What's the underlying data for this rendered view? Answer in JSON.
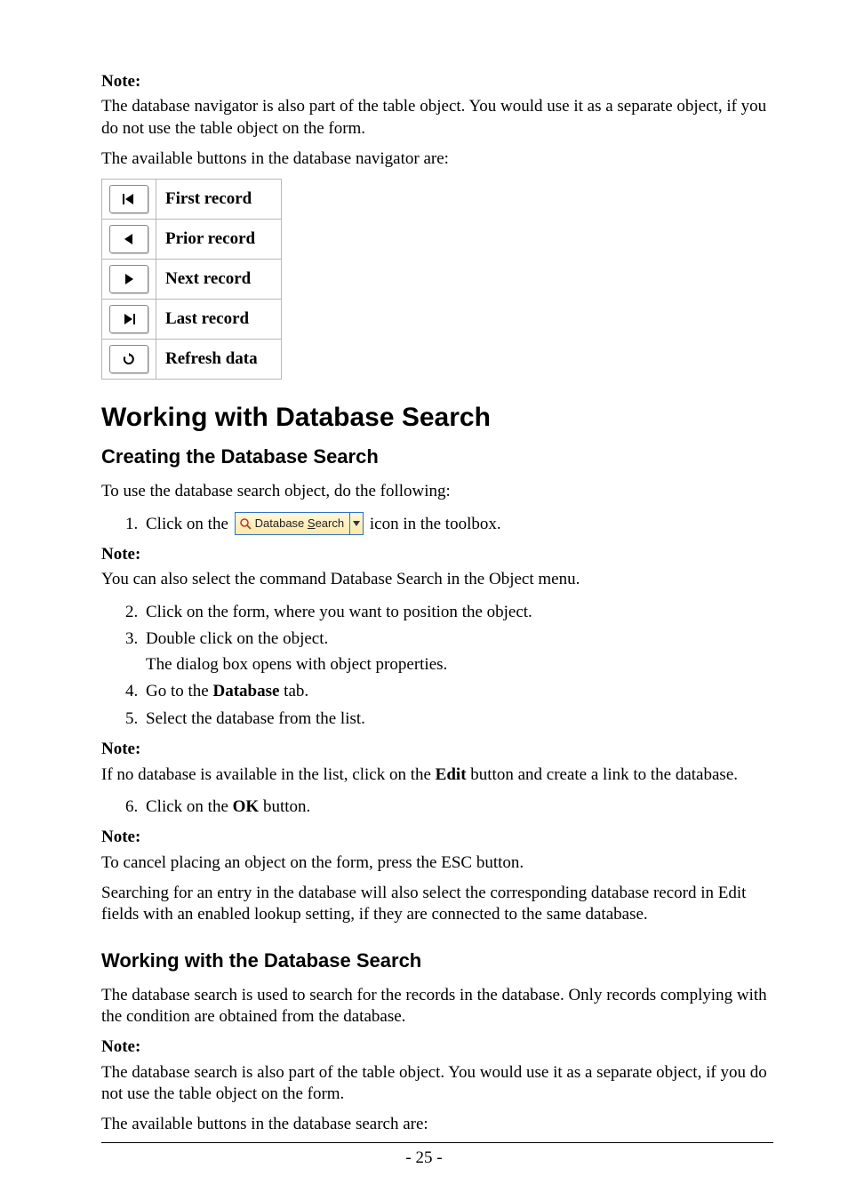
{
  "note_label": "Note:",
  "intro_note_body": " The database navigator is also part of the table object. You would use it as a separate object, if you do not use the table object on the form.",
  "navigator_intro": "The available buttons in the database navigator are:",
  "nav_rows": {
    "first": "First record",
    "prior": "Prior record",
    "next": "Next record",
    "last": "Last record",
    "refresh": "Refresh data"
  },
  "h1": "Working with Database Search",
  "h2a": "Creating the Database Search",
  "creating_intro": "To use the database search object, do the following:",
  "step1_pre": "Click on the ",
  "step1_post": " icon in the toolbox.",
  "ds_chip_label_pre": "Database ",
  "ds_chip_label_u": "S",
  "ds_chip_label_post": "earch",
  "note2_body": "You can also select the command Database Search in the Object menu.",
  "step2": "Click on the form, where you want to position the object.",
  "step3": "Double click on the object.",
  "step3_sub": "The dialog box opens with object properties.",
  "step4_pre": "Go to the ",
  "step4_bold": "Database",
  "step4_post": " tab.",
  "step5": "Select the database from the list.",
  "note3_pre": "If no database is available in the list, click on the ",
  "note3_bold": "Edit",
  "note3_post": " button and create a link to the database.",
  "step6_pre": "Click on the ",
  "step6_bold": "OK",
  "step6_post": " button.",
  "note4_body": "To cancel placing an object on the form, press the ESC button.",
  "search_paragraph": "Searching for an entry in the database will also select the corresponding database record in Edit fields with an enabled lookup setting, if they are connected to the same database.",
  "h2b": "Working with the Database Search",
  "working_intro": "The database search is used to search for the records in the database. Only records complying with the condition are obtained from the database.",
  "note5_body": " The database search is also part of the table object. You would use it as a separate object, if you do not use the table object on the form.",
  "search_buttons_intro": "The available buttons in the database search are:",
  "page_number": "- 25 -"
}
